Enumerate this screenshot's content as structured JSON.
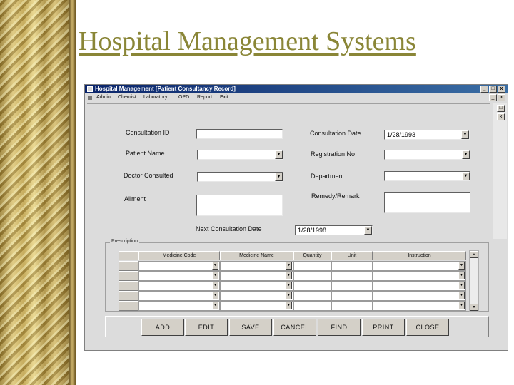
{
  "slide": {
    "title": "Hospital Management Systems"
  },
  "window": {
    "title": "Hospital Management    [Patient Consultancy Record]",
    "controls": {
      "minimize": "_",
      "maximize": "□",
      "close": "x"
    }
  },
  "menu": {
    "items": [
      "Admin",
      "Chemist",
      "Laboratory",
      "OPD",
      "Report",
      "Exit"
    ],
    "mdi_controls": {
      "minimize": "_",
      "restore": "□",
      "close": "x"
    }
  },
  "form": {
    "consultation_id": {
      "label": "Consultation ID",
      "value": ""
    },
    "consultation_date": {
      "label": "Consultation Date",
      "value": "1/28/1993"
    },
    "patient_name": {
      "label": "Patient Name",
      "value": ""
    },
    "registration_no": {
      "label": "Registration No",
      "value": ""
    },
    "doctor_consulted": {
      "label": "Doctor Consulted",
      "value": ""
    },
    "department": {
      "label": "Department",
      "value": ""
    },
    "ailment": {
      "label": "Ailment",
      "value": ""
    },
    "remedy_remark": {
      "label": "Remedy/Remark",
      "value": ""
    },
    "next_consultation_date": {
      "label": "Next Consultation Date",
      "value": "1/28/1998"
    }
  },
  "prescription": {
    "label": "Prescription",
    "columns": [
      "Medicine Code",
      "Medicine Name",
      "Quantity",
      "Unit",
      "Instruction"
    ],
    "rows": [
      [
        "",
        "",
        "",
        "",
        ""
      ],
      [
        "",
        "",
        "",
        "",
        ""
      ],
      [
        "",
        "",
        "",
        "",
        ""
      ],
      [
        "",
        "",
        "",
        "",
        ""
      ],
      [
        "",
        "",
        "",
        "",
        ""
      ]
    ]
  },
  "buttons": {
    "add": "ADD",
    "edit": "EDIT",
    "save": "SAVE",
    "cancel": "CANCEL",
    "find": "FIND",
    "print": "PRINT",
    "close": "CLOSE"
  },
  "icons": {
    "dropdown": "▼",
    "scroll_up": "▲",
    "scroll_down": "▼"
  },
  "colors": {
    "title": "#8a8637",
    "titlebar_start": "#0a246a",
    "titlebar_end": "#3a6ea5",
    "window_bg": "#dcdcdc"
  }
}
